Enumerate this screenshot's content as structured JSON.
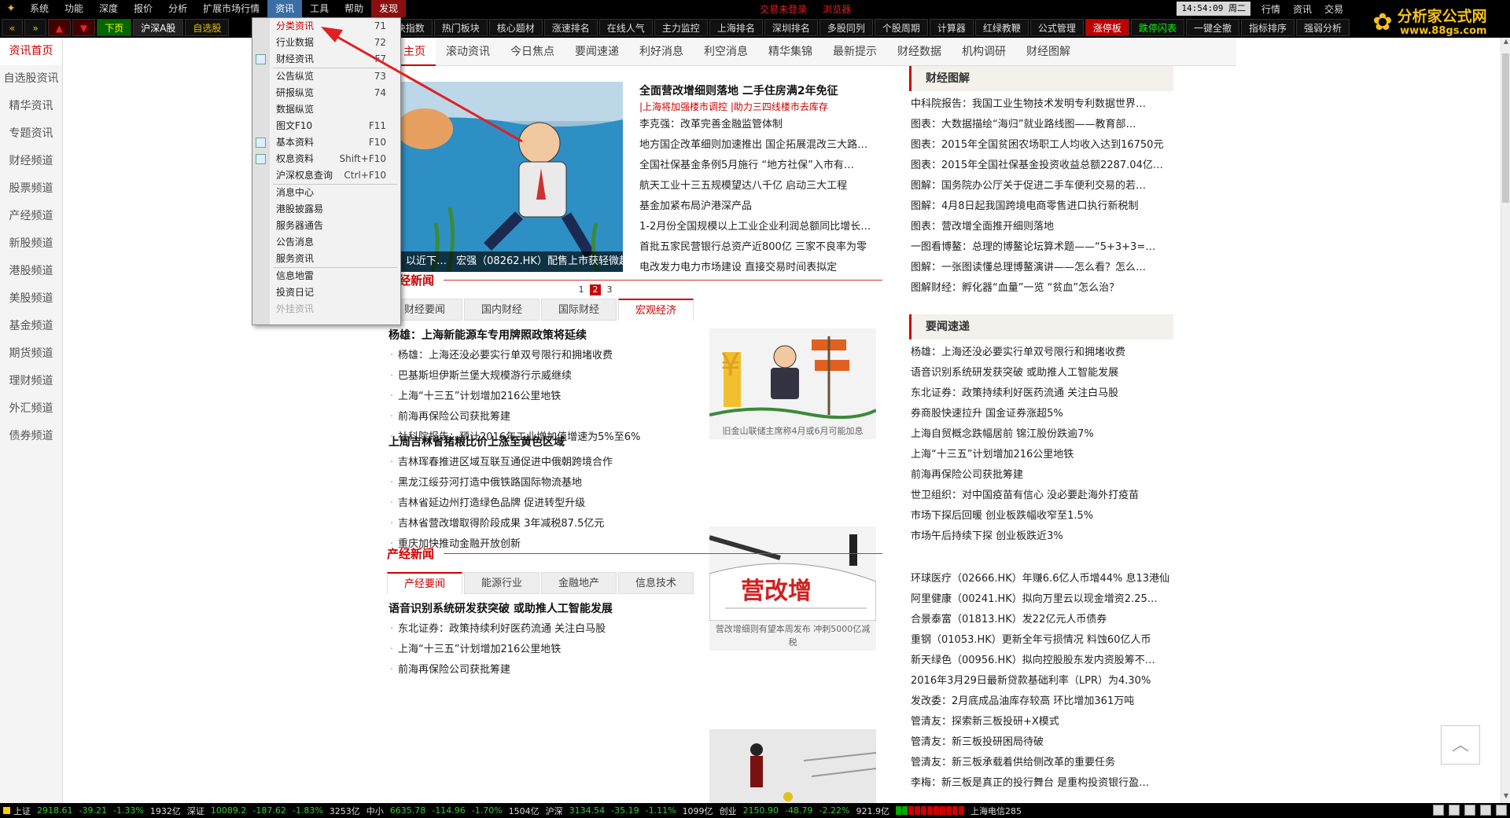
{
  "menubar": {
    "items": [
      "系统",
      "功能",
      "深度",
      "报价",
      "分析",
      "扩展市场行情",
      "资讯",
      "工具",
      "帮助"
    ],
    "fx_label": "发现",
    "alerts": [
      "交易未登录",
      "浏览器"
    ],
    "clock": "14:54:09 周二",
    "right_items": [
      "行情",
      "资讯",
      "交易"
    ]
  },
  "brand": {
    "title": "分析家公式网",
    "url": "www.88gs.com"
  },
  "toolbar": {
    "nav_back": "«",
    "nav_fwd": "»",
    "up": "▲",
    "down": "▼",
    "next_page": "下页",
    "buttons": [
      "沪深A股",
      "自选股"
    ],
    "right_buttons": [
      "板块指数",
      "热门板块",
      "核心题材",
      "涨速排名",
      "在线人气",
      "主力监控",
      "上海排名",
      "深圳排名",
      "多股同列",
      "个股周期",
      "计算器",
      "红绿教鞭",
      "公式管理",
      "涨停板",
      "跌停闪表",
      "一键全撤",
      "指标排序",
      "强弱分析"
    ]
  },
  "sidebar": {
    "items": [
      "资讯首页",
      "自选股资讯",
      "精华资讯",
      "专题资讯",
      "财经频道",
      "股票频道",
      "产经频道",
      "新股频道",
      "港股频道",
      "美股频道",
      "基金频道",
      "期货频道",
      "理财频道",
      "外汇频道",
      "债券频道"
    ]
  },
  "nav": {
    "items": [
      "主页",
      "滚动资讯",
      "今日焦点",
      "要闻速递",
      "利好消息",
      "利空消息",
      "精华集锦",
      "最新提示",
      "财经数据",
      "机构调研",
      "财经图解"
    ]
  },
  "carousel": {
    "caption_left": "以近下…",
    "caption": "宏强（08262.HK）配售上市获轻微超",
    "pages": [
      "1",
      "2",
      "3"
    ],
    "current": "2"
  },
  "headline": {
    "title": "全面营改增细则落地 二手住房满2年免征",
    "sub1": "|上海将加强楼市调控",
    "sub2": "|助力三四线楼市去库存",
    "items": [
      "李克强：改革完善金融监管体制",
      "地方国企改革细则加速推出 国企拓展混改三大路…",
      "全国社保基金条例5月施行 “地方社保”入市有…",
      "航天工业十三五规模望达八千亿 启动三大工程",
      "基金加紧布局沪港深产品",
      "1-2月份全国规模以上工业企业利润总额同比增长…",
      "首批五家民营银行总资产近800亿 三家不良率为零",
      "电改发力电力市场建设 直接交易时间表拟定"
    ]
  },
  "finance": {
    "heading": "财经新闻",
    "tabs": [
      "财经要闻",
      "国内财经",
      "国际财经",
      "宏观经济"
    ],
    "active_tab": "宏观经济",
    "group1_title": "杨雄：上海新能源车专用牌照政策将延续",
    "group1": [
      "杨雄：上海还没必要实行单双号限行和拥堵收费",
      "巴基斯坦伊斯兰堡大规模游行示威继续",
      "上海“十三五”计划增加216公里地铁",
      "前海再保险公司获批筹建",
      "社科院报告：预计2016年工业增加值增速为5%至6%"
    ],
    "pic1_caption": "旧金山联储主席称4月或6月可能加息",
    "group2_title": "上周吉林省猪粮比价上涨至黄色区域",
    "group2": [
      "吉林珲春推进区域互联互通促进中俄朝跨境合作",
      "黑龙江绥芬河打造中俄铁路国际物流基地",
      "吉林省延边州打造绿色品牌 促进转型升级",
      "吉林省营改增取得阶段成果 3年减税87.5亿元",
      "重庆加快推动金融开放创新"
    ],
    "pic2_caption": "营改增细则有望本周发布 冲刺5000亿减税",
    "pic2_label": "营改增"
  },
  "industry": {
    "heading": "产经新闻",
    "tabs": [
      "产经要闻",
      "能源行业",
      "金融地产",
      "信息技术"
    ],
    "active_tab": "产经要闻",
    "group_title": "语音识别系统研发获突破 或助推人工智能发展",
    "items": [
      "东北证券：政策持续利好医药流通 关注白马股",
      "上海“十三五”计划增加216公里地铁",
      "前海再保险公司获批筹建"
    ]
  },
  "right_graphics": {
    "heading": "财经图解",
    "items": [
      "中科院报告：我国工业生物技术发明专利数据世界…",
      "图表：大数据描绘“海归”就业路线图——教育部…",
      "图表：2015年全国贫困农场职工人均收入达到16750元",
      "图表：2015年全国社保基金投资收益总额2287.04亿…",
      "图解：国务院办公厅关于促进二手车便利交易的若…",
      "图解：4月8日起我国跨境电商零售进口执行新税制",
      "图表：营改增全面推开细则落地",
      "一图看博鳌：总理的博鳌论坛算术题——“5+3+3=…",
      "图解：一张图读懂总理博鳌演讲——怎么看？怎么…",
      "图解财经：孵化器“血量”一览 “贫血”怎么治？"
    ]
  },
  "right_news": {
    "heading": "要闻速递",
    "items": [
      "杨雄：上海还没必要实行单双号限行和拥堵收费",
      "语音识别系统研发获突破 或助推人工智能发展",
      "东北证券：政策持续利好医药流通 关注白马股",
      "券商股快速拉升 国金证券涨超5%",
      "上海自贸概念跌幅居前 锦江股份跌逾7%",
      "上海“十三五”计划增加216公里地铁",
      "前海再保险公司获批筹建",
      "世卫组织：对中国疫苗有信心 没必要赴海外打疫苗",
      "市场下探后回暖 创业板跌幅收窄至1.5%",
      "市场午后持续下探 创业板跌近3%"
    ],
    "items2": [
      "环球医疗（02666.HK）年赚6.6亿人币增44% 息13港仙",
      "阿里健康（00241.HK）拟向万里云以现金增资2.25…",
      "合景泰富（01813.HK）发22亿元人币债券",
      "重钢（01053.HK）更新全年亏损情况 料蚀60亿人币",
      "新天绿色（00956.HK）拟向控股股东发内资股筹不…",
      "2016年3月29日最新贷款基础利率（LPR）为4.30%",
      "发改委：2月底成品油库存较高 环比增加361万吨",
      "管清友：探索新三板投研+X模式",
      "管清友：新三板投研困局待破",
      "管清友：新三板承载着供给侧改革的重要任务",
      "李梅：新三板是真正的投行舞台 是重构投资银行盈…"
    ]
  },
  "dropdown": {
    "items": [
      {
        "label": "分类资讯",
        "key": "71",
        "sel": true
      },
      {
        "label": "行业数据",
        "key": "72"
      },
      {
        "label": "财经资讯",
        "key": "F7",
        "icon": true
      },
      {
        "sep": true
      },
      {
        "label": "公告纵览",
        "key": "73"
      },
      {
        "label": "研报纵览",
        "key": "74"
      },
      {
        "label": "数据纵览",
        "key": ""
      },
      {
        "label": "图文F10",
        "key": "F11"
      },
      {
        "label": "基本资料",
        "key": "F10",
        "icon": true
      },
      {
        "label": "权息资料",
        "key": "Shift+F10",
        "icon": true
      },
      {
        "label": "沪深权息查询",
        "key": "Ctrl+F10"
      },
      {
        "sep": true
      },
      {
        "label": "消息中心",
        "key": ""
      },
      {
        "label": "港股披露易",
        "key": ""
      },
      {
        "label": "服务器通告",
        "key": ""
      },
      {
        "label": "公告消息",
        "key": ""
      },
      {
        "label": "服务资讯",
        "key": ""
      },
      {
        "sep": true
      },
      {
        "label": "信息地雷",
        "key": ""
      },
      {
        "label": "投资日记",
        "key": ""
      },
      {
        "label": "外挂资讯",
        "key": "",
        "dis": true
      }
    ]
  },
  "statusbar": {
    "sh_label": "上证",
    "sh_val": "2918.61",
    "sh_chg": "-39.21",
    "sh_pct": "-1.33%",
    "sh_amt": "1932亿",
    "sz_label": "深证",
    "sz_val": "10089.2",
    "sz_chg": "-187.62",
    "sz_pct": "-1.83%",
    "sz_amt": "3253亿",
    "zx_label": "中小",
    "zx_val": "6635.78",
    "zx_chg": "-114.96",
    "zx_pct": "-1.70%",
    "zx_amt": "1504亿",
    "hs_label": "沪深",
    "hs_val": "3134.54",
    "hs_chg": "-35.19",
    "hs_pct": "-1.11%",
    "hs_amt": "1099亿",
    "cy_label": "创业",
    "cy_val": "2150.90",
    "cy_chg": "-48.79",
    "cy_pct": "-2.22%",
    "cy_amt": "921.9亿",
    "server": "上海电信285"
  }
}
